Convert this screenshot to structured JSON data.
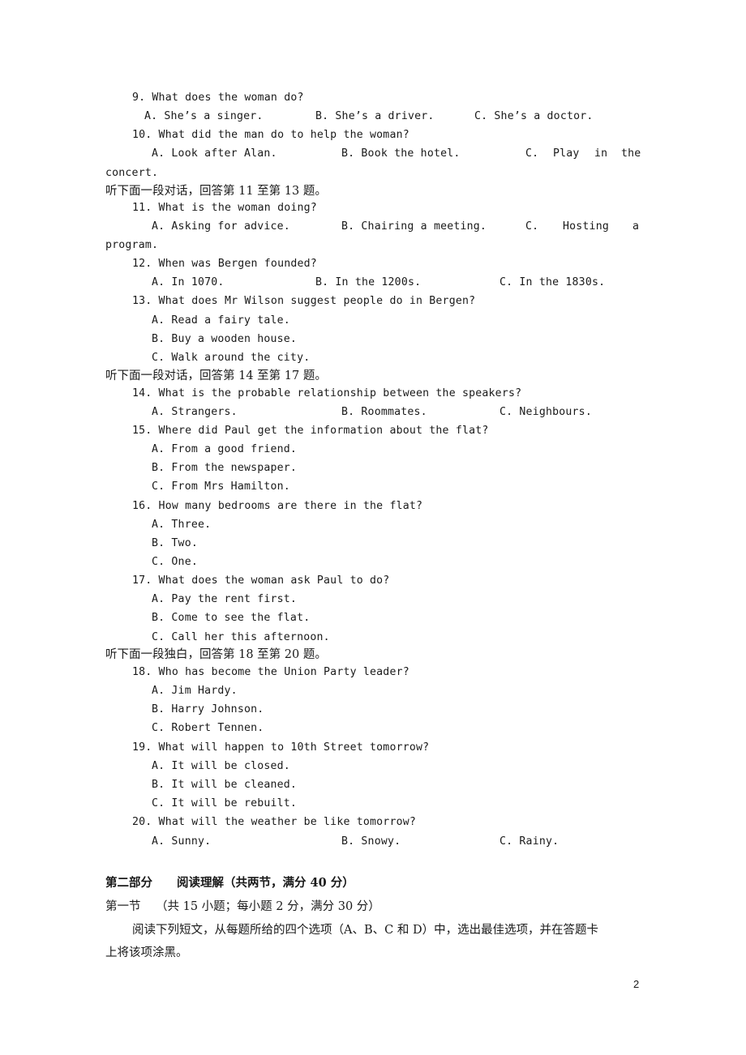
{
  "questions": {
    "q9": {
      "stem": "9. What does the woman do?",
      "a": "A. She’s a singer.",
      "b": "B. She’s a driver.",
      "c": "C. She’s a doctor."
    },
    "q10": {
      "stem": "10. What did the man do to help the woman?",
      "a": "A. Look after Alan.",
      "b": "B. Book the hotel.",
      "c_1": "C.",
      "c_2": "Play",
      "c_3": "in",
      "c_4": "the",
      "c_wrap": "concert."
    },
    "inst_11_13": "听下面一段对话，回答第 11 至第 13 题。",
    "q11": {
      "stem": "11. What is the woman doing?",
      "a": "A. Asking for advice.",
      "b": "B. Chairing a meeting.",
      "c_1": "C.",
      "c_2": "Hosting",
      "c_3": "a",
      "c_wrap": "program."
    },
    "q12": {
      "stem": "12. When was Bergen founded?",
      "a": "A. In 1070.",
      "b": "B. In the 1200s.",
      "c": "C. In the 1830s."
    },
    "q13": {
      "stem": "13. What does Mr Wilson suggest people do in Bergen?",
      "a": "A. Read a fairy tale.",
      "b": "B. Buy a wooden house.",
      "c": "C. Walk around the city."
    },
    "inst_14_17": "听下面一段对话，回答第 14 至第 17 题。",
    "q14": {
      "stem": "14. What is the probable relationship between the speakers?",
      "a": "A. Strangers.",
      "b": "B. Roommates.",
      "c": "C. Neighbours."
    },
    "q15": {
      "stem": "15. Where did Paul get the information about the flat?",
      "a": "A. From a good friend.",
      "b": "B. From the newspaper.",
      "c": "C. From Mrs Hamilton."
    },
    "q16": {
      "stem": "16. How many bedrooms are there in the flat?",
      "a": "A. Three.",
      "b": "B. Two.",
      "c": "C. One."
    },
    "q17": {
      "stem": "17. What does the woman ask Paul to do?",
      "a": "A. Pay the rent first.",
      "b": "B. Come to see the flat.",
      "c": "C. Call her this afternoon."
    },
    "inst_18_20": "听下面一段独白，回答第 18 至第 20 题。",
    "q18": {
      "stem": "18. Who has become the Union Party leader?",
      "a": "A. Jim Hardy.",
      "b": "B. Harry Johnson.",
      "c": "C. Robert Tennen."
    },
    "q19": {
      "stem": "19. What will happen to 10th Street tomorrow?",
      "a": "A. It will be closed.",
      "b": "B. It will be cleaned.",
      "c": "C. It will be rebuilt."
    },
    "q20": {
      "stem": "20. What will the weather be like tomorrow?",
      "a": "A. Sunny.",
      "b": "B. Snowy.",
      "c": "C. Rainy."
    }
  },
  "part2": {
    "heading_1": "第二部分",
    "heading_2": "阅读理解（共两节，满分 40 分）",
    "section_1_label": "第一节",
    "section_1_info": "（共 15 小题；每小题 2 分，满分 30 分）",
    "instruction_line1": "阅读下列短文，从每题所给的四个选项（A、B、C 和 D）中，选出最佳选项，并在答题卡",
    "instruction_line2": "上将该项涂黑。"
  },
  "page_number": "2"
}
